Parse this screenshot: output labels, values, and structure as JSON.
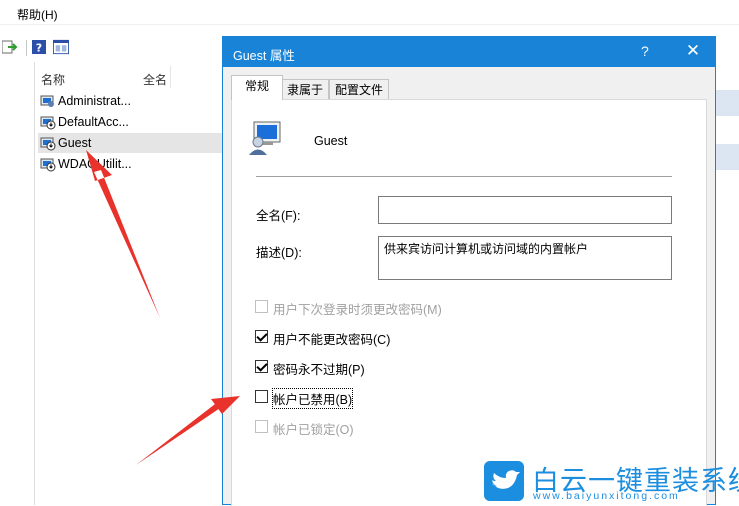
{
  "menu": {
    "help_label": "帮助(H)"
  },
  "list": {
    "col_name": "名称",
    "col_fullname": "全名",
    "items": [
      {
        "label": "Administrat..."
      },
      {
        "label": "DefaultAcc..."
      },
      {
        "label": "Guest"
      },
      {
        "label": "WDAGUtilit..."
      }
    ]
  },
  "dialog": {
    "title": "Guest 属性",
    "help_glyph": "?",
    "close_glyph": "✕",
    "tabs": [
      {
        "label": "常规"
      },
      {
        "label": "隶属于"
      },
      {
        "label": "配置文件"
      }
    ],
    "user_name": "Guest",
    "fullname_label": "全名(F):",
    "fullname_value": "",
    "description_label": "描述(D):",
    "description_value": "供来宾访问计算机或访问域的内置帐户",
    "checkboxes": [
      {
        "label": "用户下次登录时须更改密码(M)",
        "checked": false,
        "disabled": true
      },
      {
        "label": "用户不能更改密码(C)",
        "checked": true,
        "disabled": false
      },
      {
        "label": "密码永不过期(P)",
        "checked": true,
        "disabled": false
      },
      {
        "label": "帐户已禁用(B)",
        "checked": false,
        "disabled": false
      },
      {
        "label": "帐户已锁定(O)",
        "checked": false,
        "disabled": true
      }
    ]
  },
  "watermark": {
    "text": "白云一键重装系统",
    "url": "www.baiyunxitong.com",
    "color": "#1c8ee0"
  },
  "colors": {
    "accent": "#1883d7",
    "annotation": "#e8322b"
  }
}
